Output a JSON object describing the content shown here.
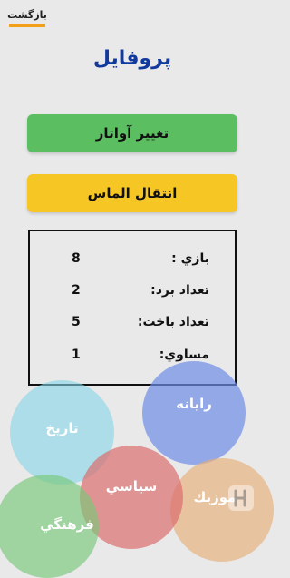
{
  "header": {
    "back_label": "بازگشت"
  },
  "page": {
    "title": "پروفايل"
  },
  "buttons": {
    "change_avatar": "تغيير آواتار",
    "transfer_diamond": "انتقال الماس"
  },
  "stats": [
    {
      "label": "بازي :",
      "value": "8"
    },
    {
      "label": "تعداد برد:",
      "value": "2"
    },
    {
      "label": "تعداد باخت:",
      "value": "5"
    },
    {
      "label": "مساوي:",
      "value": "1"
    }
  ],
  "categories": {
    "history": "تاريخ",
    "computer": "رايانه",
    "politic": "سياسي",
    "music": "موزيك",
    "culture": "فرهنگي"
  },
  "colors": {
    "title": "#123a9c",
    "avatar_button": "#5bbf62",
    "diamond_button": "#f6c625",
    "back_underline": "#f2a019"
  }
}
